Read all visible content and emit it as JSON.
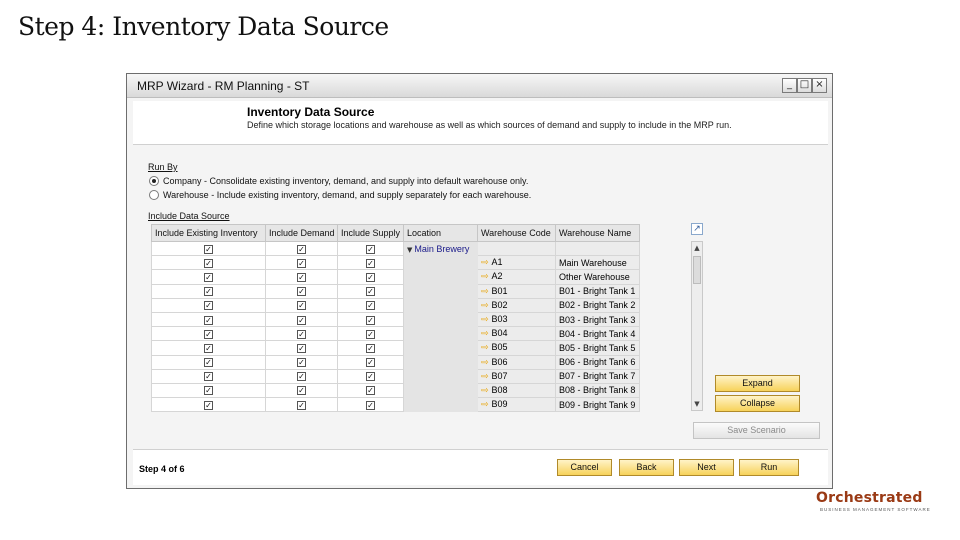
{
  "slide": {
    "title": "Step 4: Inventory Data Source"
  },
  "window": {
    "title": "MRP Wizard - RM Planning - ST",
    "controls": {
      "minimize": "_",
      "maximize": "□",
      "close": "×"
    }
  },
  "header": {
    "title": "Inventory Data Source",
    "description": "Define which storage locations and warehouse as well as which sources of demand and supply to include in the MRP run."
  },
  "run_by": {
    "label": "Run By",
    "options": [
      {
        "label": "Company - Consolidate existing inventory, demand, and supply into default warehouse only.",
        "selected": true
      },
      {
        "label": "Warehouse - Include existing inventory, demand, and supply separately for each warehouse.",
        "selected": false
      }
    ]
  },
  "data_source": {
    "label": "Include Data Source",
    "columns": [
      "Include Existing Inventory",
      "Include Demand",
      "Include Supply",
      "Location",
      "Warehouse Code",
      "Warehouse Name"
    ],
    "group_row": {
      "location": "Main Brewery",
      "checked": [
        true,
        true,
        true
      ]
    },
    "rows": [
      {
        "code": "A1",
        "name": "Main Warehouse",
        "checked": [
          true,
          true,
          true
        ]
      },
      {
        "code": "A2",
        "name": "Other Warehouse",
        "checked": [
          true,
          true,
          true
        ]
      },
      {
        "code": "B01",
        "name": "B01 - Bright Tank 1",
        "checked": [
          true,
          true,
          true
        ]
      },
      {
        "code": "B02",
        "name": "B02 - Bright Tank 2",
        "checked": [
          true,
          true,
          true
        ]
      },
      {
        "code": "B03",
        "name": "B03 - Bright Tank 3",
        "checked": [
          true,
          true,
          true
        ]
      },
      {
        "code": "B04",
        "name": "B04 - Bright Tank 4",
        "checked": [
          true,
          true,
          true
        ]
      },
      {
        "code": "B05",
        "name": "B05 - Bright Tank 5",
        "checked": [
          true,
          true,
          true
        ]
      },
      {
        "code": "B06",
        "name": "B06 - Bright Tank 6",
        "checked": [
          true,
          true,
          true
        ]
      },
      {
        "code": "B07",
        "name": "B07 - Bright Tank 7",
        "checked": [
          true,
          true,
          true
        ]
      },
      {
        "code": "B08",
        "name": "B08 - Bright Tank 8",
        "checked": [
          true,
          true,
          true
        ]
      },
      {
        "code": "B09",
        "name": "B09 - Bright Tank 9",
        "checked": [
          true,
          true,
          true
        ]
      }
    ]
  },
  "buttons": {
    "expand": "Expand",
    "collapse": "Collapse",
    "save_scenario": "Save Scenario",
    "cancel": "Cancel",
    "back": "Back",
    "next": "Next",
    "run": "Run"
  },
  "footer": {
    "step": "Step 4 of 6"
  },
  "logo": {
    "name": "Orchestrated",
    "tagline": "BUSINESS MANAGEMENT SOFTWARE"
  },
  "colors": {
    "button_fill": "#f7d25a",
    "arrow": "#e8a200",
    "logo": "#9a3a15",
    "location_text": "#1a1a8a"
  }
}
